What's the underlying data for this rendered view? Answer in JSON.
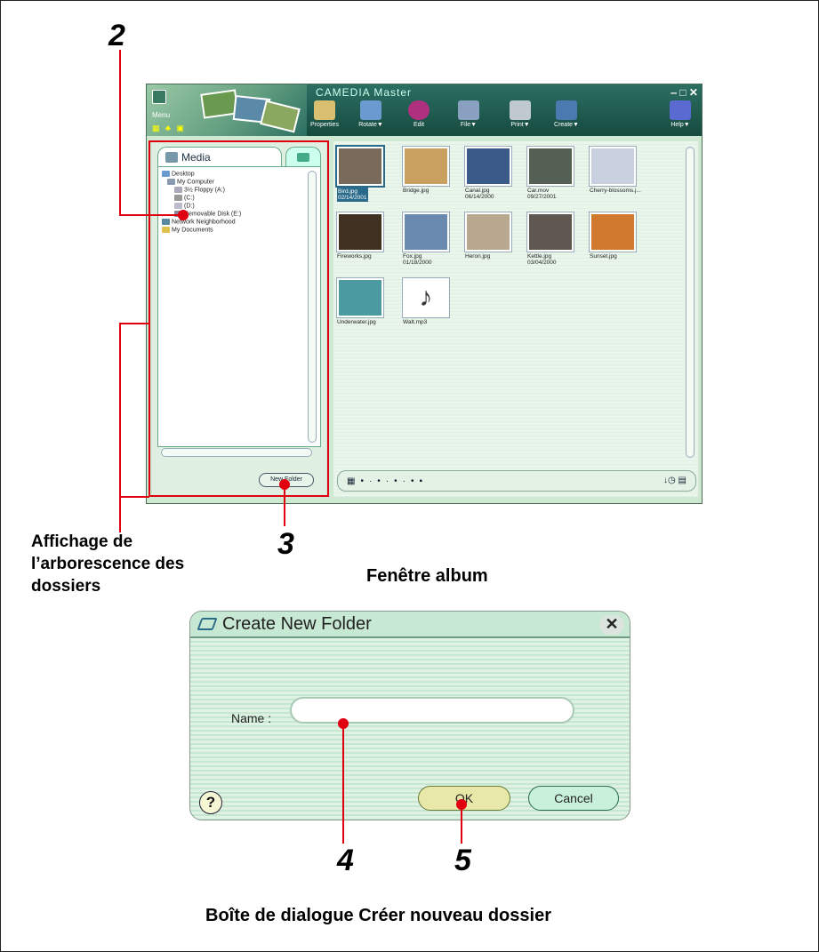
{
  "callouts": {
    "n2": "2",
    "n3": "3",
    "n4": "4",
    "n5": "5"
  },
  "captions": {
    "tree_line1": "Affichage de",
    "tree_line2": "l’arborescence des",
    "tree_line3": "dossiers",
    "album": "Fenêtre album",
    "dialog": "Boîte de dialogue Créer nouveau dossier"
  },
  "album": {
    "title": "CAMEDIA Master",
    "menu_label": "Menu",
    "toolbar": [
      "Properties",
      "Rotate▼",
      "Edit",
      "File▼",
      "Print▼",
      "Create▼",
      "Help▼"
    ],
    "tab_media": "Media",
    "tree": [
      {
        "label": "Desktop",
        "icon": "desktop-icon"
      },
      {
        "label": "My Computer",
        "icon": "computer-icon"
      },
      {
        "label": "3½ Floppy (A:)",
        "icon": "floppy-icon"
      },
      {
        "label": "(C:)",
        "icon": "drive-icon"
      },
      {
        "label": "(D:)",
        "icon": "cd-icon"
      },
      {
        "label": "Removable Disk (E:)",
        "icon": "removable-disk-icon"
      },
      {
        "label": "Network Neighborhood",
        "icon": "network-icon"
      },
      {
        "label": "My Documents",
        "icon": "folder-icon"
      }
    ],
    "new_folder": "New Folder",
    "thumbs": [
      {
        "name": "Bird.jpg",
        "date": "02/14/2001",
        "selected": true,
        "color": "#7a6a5a"
      },
      {
        "name": "Bridge.jpg",
        "date": "",
        "selected": false,
        "color": "#c9a060"
      },
      {
        "name": "Canal.jpg",
        "date": "06/14/2000",
        "selected": false,
        "color": "#3a5a8a"
      },
      {
        "name": "Car.mov",
        "date": "09/27/2001",
        "selected": false,
        "color": "#556055"
      },
      {
        "name": "Cherry-blossoms.j...",
        "date": "",
        "selected": false,
        "color": "#c8d0e0"
      },
      {
        "name": "Fireworks.jpg",
        "date": "",
        "selected": false,
        "color": "#403020"
      },
      {
        "name": "Fox.jpg",
        "date": "01/18/2000",
        "selected": false,
        "color": "#6a8ab0"
      },
      {
        "name": "Heron.jpg",
        "date": "",
        "selected": false,
        "color": "#b8a890"
      },
      {
        "name": "Kettle.jpg",
        "date": "03/04/2000",
        "selected": false,
        "color": "#605850"
      },
      {
        "name": "Sunset.jpg",
        "date": "",
        "selected": false,
        "color": "#d07a30"
      },
      {
        "name": "Underwater.jpg",
        "date": "",
        "selected": false,
        "color": "#4a9aa0"
      },
      {
        "name": "Walt.mp3",
        "date": "",
        "selected": false,
        "color": "#ffffff"
      }
    ]
  },
  "dialog": {
    "title": "Create New Folder",
    "name_label": "Name :",
    "name_value": "",
    "help": "?",
    "ok": "OK",
    "cancel": "Cancel",
    "close": "✕"
  },
  "colors": {
    "callout_red": "#e00010",
    "dialog_green": "#c7e8d2",
    "ok_yellow": "#e8e9a8"
  }
}
